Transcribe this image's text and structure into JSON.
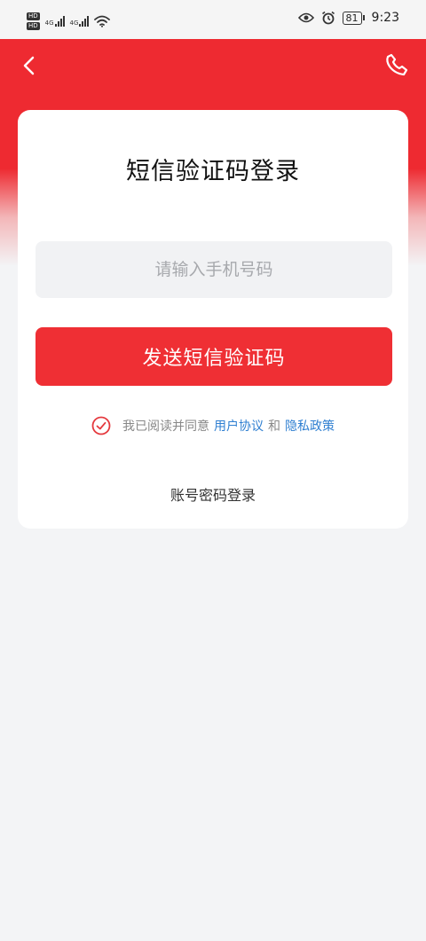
{
  "status_bar": {
    "hd1": "HD",
    "hd2": "HD",
    "net1": "4G",
    "net2": "4G",
    "battery": "81",
    "time": "9:23"
  },
  "login": {
    "title": "短信验证码登录",
    "phone_placeholder": "请输入手机号码",
    "send_button": "发送短信验证码",
    "agree_text": "我已阅读并同意",
    "user_agreement": "用户协议",
    "and_text": "和",
    "privacy_policy": "隐私政策",
    "alt_login": "账号密码登录"
  },
  "colors": {
    "brand_red": "#ee2a31",
    "link_blue": "#2f7fd1",
    "page_bg": "#f3f4f6"
  },
  "icons": {
    "back": "chevron-left-icon",
    "phone": "phone-icon",
    "check": "check-circle-icon"
  }
}
